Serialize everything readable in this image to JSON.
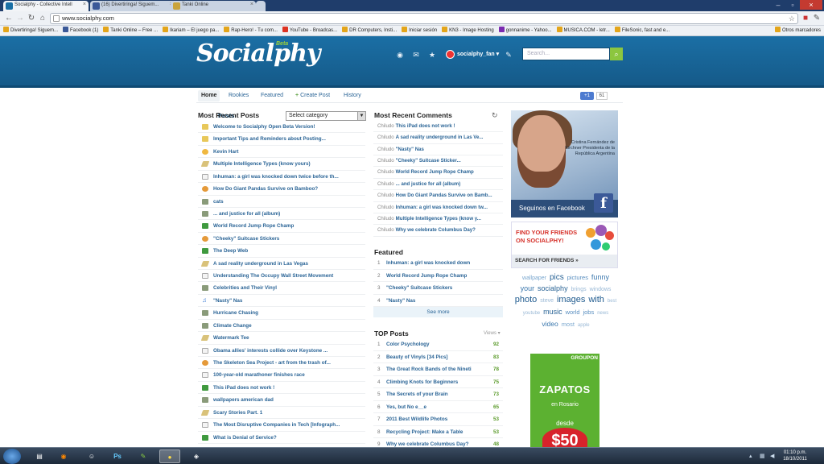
{
  "browser": {
    "tabs": [
      {
        "label": "Socialphy - Collective Intell",
        "active": true
      },
      {
        "label": "(16) Divertiringa! Siguem...",
        "active": false
      },
      {
        "label": "Tanki Online",
        "active": false
      }
    ],
    "url": "www.socialphy.com",
    "bookmarks": [
      "Divertiringa! Siguem...",
      "Facebook (1)",
      "Tanki Online – Free ...",
      "Ikariam – El juego pa...",
      "Rap-Hero! - Tu com...",
      "YouTube - Broadcas...",
      "DR Computers, Insti...",
      "Iniciar sesión",
      "KN3 - Image Hosting",
      "gonnanime - Yahoo...",
      "MUSICA.COM - letr...",
      "FileSonic, fast and e..."
    ],
    "other_bookmarks": "Otros marcadores"
  },
  "site": {
    "logo": "Socialphy",
    "beta": "Beta",
    "username": "socialphy_fan",
    "search_placeholder": "Search...",
    "main_tabs": [
      "Posts",
      "Communities",
      "TOPs"
    ],
    "sub_nav": {
      "home": "Home",
      "rookies": "Rookies",
      "featured": "Featured",
      "create": "Create Post",
      "history": "History"
    },
    "gplus_label": "+1",
    "gplus_count": "61"
  },
  "recent_posts": {
    "title": "Most Recent Posts",
    "category_select": "Select category",
    "items": [
      {
        "icon": "folder",
        "title": "Welcome to Socialphy Open Beta Version!"
      },
      {
        "icon": "folder",
        "title": "Important Tips and Reminders about Posting..."
      },
      {
        "icon": "smile",
        "title": "Kevin Hart"
      },
      {
        "icon": "pencil",
        "title": "Multiple Intelligence Types (know yours)"
      },
      {
        "icon": "doc",
        "title": "Inhuman: a girl was knocked down twice before th..."
      },
      {
        "icon": "emo",
        "title": "How Do Giant Pandas Survive on Bamboo?"
      },
      {
        "icon": "img",
        "title": "cats"
      },
      {
        "icon": "img",
        "title": "... and justice for all (album)"
      },
      {
        "icon": "note",
        "title": "World Record Jump Rope Champ"
      },
      {
        "icon": "emo",
        "title": "\"Cheeky\" Suitcase Stickers"
      },
      {
        "icon": "note",
        "title": "The Deep Web"
      },
      {
        "icon": "pencil",
        "title": "A sad reality underground in Las Vegas"
      },
      {
        "icon": "doc",
        "title": "Understanding The Occupy Wall Street Movement"
      },
      {
        "icon": "img",
        "title": "Celebrities and Their Vinyl"
      },
      {
        "icon": "music",
        "title": "\"Nasty\" Nas"
      },
      {
        "icon": "img",
        "title": "Hurricane Chasing"
      },
      {
        "icon": "img",
        "title": "Climate Change"
      },
      {
        "icon": "pencil",
        "title": "Watermark Tee"
      },
      {
        "icon": "doc",
        "title": "Obama allies' interests collide over Keystone ..."
      },
      {
        "icon": "emo",
        "title": "The Skeleton Sea Project - art from the trash of..."
      },
      {
        "icon": "doc",
        "title": "100-year-old marathoner finishes race"
      },
      {
        "icon": "note",
        "title": "This iPad does not work !"
      },
      {
        "icon": "img",
        "title": "wallpapers american dad"
      },
      {
        "icon": "pencil",
        "title": "Scary Stories Part. 1"
      },
      {
        "icon": "doc",
        "title": "The Most Disruptive Companies in Tech [Infograph..."
      },
      {
        "icon": "note",
        "title": "What is Denial of Service?"
      }
    ]
  },
  "recent_comments": {
    "title": "Most Recent Comments",
    "items": [
      {
        "by": "Chiludo",
        "title": "This iPad does not work !"
      },
      {
        "by": "Chiludo",
        "title": "A sad reality underground in Las Ve..."
      },
      {
        "by": "Chiludo",
        "title": "\"Nasty\" Nas"
      },
      {
        "by": "Chiludo",
        "title": "\"Cheeky\" Suitcase Sticker..."
      },
      {
        "by": "Chiludo",
        "title": "World Record Jump Rope Champ"
      },
      {
        "by": "Chiludo",
        "title": "... and justice for all (album)"
      },
      {
        "by": "Chiludo",
        "title": "How Do Giant Pandas Survive on Bamb..."
      },
      {
        "by": "Chiludo",
        "title": "Inhuman: a girl was knocked down tw..."
      },
      {
        "by": "Chiludo",
        "title": "Multiple Intelligence Types (know y..."
      },
      {
        "by": "Chiludo",
        "title": "Why we celebrate Columbus Day?"
      }
    ]
  },
  "featured": {
    "title": "Featured",
    "items": [
      {
        "n": "1",
        "title": "Inhuman: a girl was knocked down"
      },
      {
        "n": "2",
        "title": "World Record Jump Rope Champ"
      },
      {
        "n": "3",
        "title": "\"Cheeky\" Suitcase Stickers"
      },
      {
        "n": "4",
        "title": "\"Nasty\" Nas"
      }
    ],
    "see_more": "See more"
  },
  "top_posts": {
    "title": "TOP Posts",
    "sort_label": "Views",
    "items": [
      {
        "n": "1",
        "title": "Color Psychology",
        "score": "92"
      },
      {
        "n": "2",
        "title": "Beauty of Vinyls [34 Pics]",
        "score": "83"
      },
      {
        "n": "3",
        "title": "The Great Rock Bands of the Nineti",
        "score": "78"
      },
      {
        "n": "4",
        "title": "Climbing Knots for Beginners",
        "score": "75"
      },
      {
        "n": "5",
        "title": "The Secrets of your Brain",
        "score": "73"
      },
      {
        "n": "6",
        "title": "Yes, but No e__e",
        "score": "65"
      },
      {
        "n": "7",
        "title": "2011 Best Wildlife Photos",
        "score": "53"
      },
      {
        "n": "8",
        "title": "Recycling Project: Make a Table",
        "score": "53"
      },
      {
        "n": "9",
        "title": "Why we celebrate Columbus Day?",
        "score": "48"
      }
    ]
  },
  "ads": {
    "ad1_caption": "Cristina Fernández de Kirchner Presidenta de la República Argentina",
    "ad1_footer": "Seguinos en Facebook",
    "ad2_line1": "FIND YOUR FRIENDS",
    "ad2_line2": "ON SOCIALPHY!",
    "ad2_button": "SEARCH FOR FRIENDS »",
    "tags": [
      "wallpaper",
      "pics",
      "pictures",
      "funny",
      "your",
      "socialphy",
      "brings",
      "windows",
      "photo",
      "steve",
      "images",
      "with",
      "best",
      "youtube",
      "music",
      "world",
      "jobs",
      "news",
      "video",
      "most",
      "apple"
    ],
    "ad3_brand": "GROUPON",
    "ad3_title": "ZAPATOS",
    "ad3_city": "en Rosario",
    "ad3_from": "desde",
    "ad3_price": "$50"
  },
  "taskbar": {
    "time": "01:10 p.m.",
    "date": "18/10/2011"
  }
}
